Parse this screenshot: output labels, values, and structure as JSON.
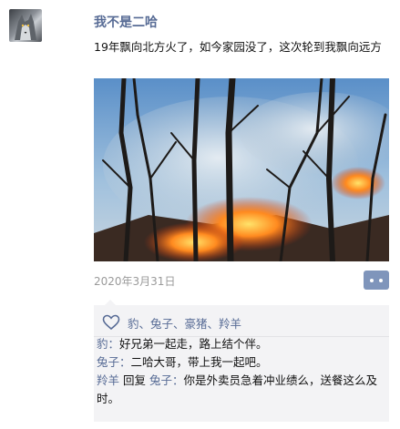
{
  "post": {
    "author": "我不是二哈",
    "text": "19年飘向北方火了，如今家园没了，这次轮到我飘向远方",
    "date": "2020年3月31日"
  },
  "likes": {
    "names": "豹、兔子、豪猪、羚羊"
  },
  "comments": [
    {
      "author": "豹",
      "sep": "：",
      "text": "好兄弟一起走，路上结个伴。"
    },
    {
      "author": "兔子",
      "sep": "：",
      "text": "二哈大哥，带上我一起吧。"
    },
    {
      "author": "羚羊",
      "reply_word": " 回复 ",
      "reply_to": "兔子",
      "sep": "：",
      "text": "你是外卖员急着冲业绩么，送餐这么及时。"
    }
  ],
  "icons": {
    "avatar": "wolf-avatar",
    "like": "heart-outline-icon",
    "more": "more-dots-icon"
  },
  "colors": {
    "name_blue": "#576b95",
    "date_gray": "#9a9a9a",
    "more_button": "#7f95bb",
    "comment_bg": "#f3f3f5"
  }
}
